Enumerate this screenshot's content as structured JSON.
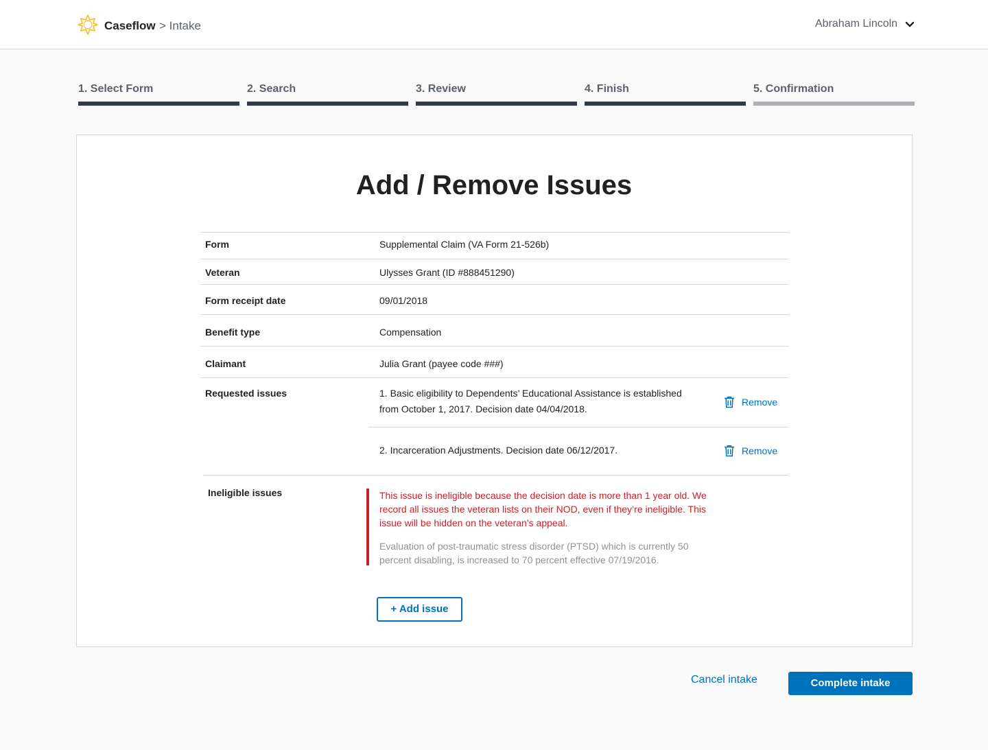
{
  "header": {
    "brand": "Caseflow",
    "breadcrumb": "> Intake",
    "user_name": "Abraham Lincoln",
    "logo_icon": "caseflow-logo-icon",
    "dropdown_icon": "chevron-down-icon"
  },
  "steps": [
    {
      "label": "1. Select Form",
      "state": "complete"
    },
    {
      "label": "2. Search",
      "state": "complete"
    },
    {
      "label": "3. Review",
      "state": "complete"
    },
    {
      "label": "4. Finish",
      "state": "current"
    },
    {
      "label": "5. Confirmation",
      "state": "pending"
    }
  ],
  "page": {
    "title": "Add / Remove Issues"
  },
  "details": {
    "form_label": "Form",
    "form_value": "Supplemental Claim (VA Form 21-526b)",
    "veteran_label": "Veteran",
    "veteran_value": "Ulysses Grant (ID #888451290)",
    "receipt_label": "Form receipt date",
    "receipt_value": "09/01/2018",
    "benefit_label": "Benefit type",
    "benefit_value": "Compensation",
    "claimant_label": "Claimant",
    "claimant_value": "Julia Grant (payee code ###)"
  },
  "requested": {
    "label": "Requested issues",
    "remove_label": "Remove",
    "issues": [
      {
        "line1": "1. Basic eligibility to Dependents’ Educational Assistance is established",
        "line2": "from October 1, 2017. Decision date 04/04/2018."
      },
      {
        "line1": "2. Incarceration Adjustments. Decision date 06/12/2017.",
        "line2": ""
      }
    ]
  },
  "ineligible": {
    "label": "Ineligible issues",
    "warning": "This issue is ineligible because the decision date is more than 1 year old. We record all issues the veteran lists on their NOD, even if they’re ineligible. This issue will be hidden on the veteran’s appeal.",
    "description": "Evaluation of post-traumatic stress disorder (PTSD) which is currently 50 percent disabling, is increased to 70 percent effective 07/19/2016."
  },
  "actions": {
    "add_issue": "+ Add issue",
    "cancel": "Cancel intake",
    "complete": "Complete intake"
  },
  "colors": {
    "link_blue": "#0071bb",
    "error_red": "#cd2026",
    "logo_yellow": "#fdb81e"
  }
}
